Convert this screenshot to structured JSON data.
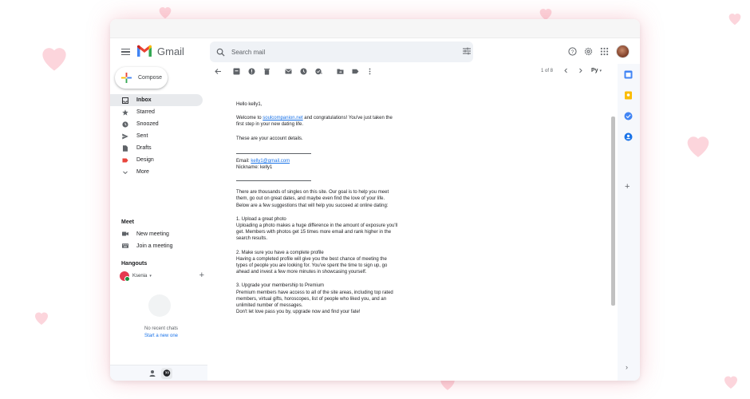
{
  "app": {
    "name": "Gmail"
  },
  "search": {
    "placeholder": "Search mail"
  },
  "compose": {
    "label": "Compose"
  },
  "nav": [
    {
      "label": "Inbox",
      "icon": "inbox-icon",
      "active": true
    },
    {
      "label": "Starred",
      "icon": "star-icon"
    },
    {
      "label": "Snoozed",
      "icon": "clock-icon"
    },
    {
      "label": "Sent",
      "icon": "send-icon"
    },
    {
      "label": "Drafts",
      "icon": "draft-icon"
    },
    {
      "label": "Design",
      "icon": "label-icon"
    },
    {
      "label": "More",
      "icon": "chevron-down-icon"
    }
  ],
  "meet": {
    "title": "Meet",
    "new_meeting": "New meeting",
    "join_meeting": "Join a meeting"
  },
  "hangouts": {
    "title": "Hangouts",
    "user": "Ksenia",
    "user_caret": "▾",
    "add": "+",
    "no_chats": "No recent chats",
    "start_chat": "Start a new one"
  },
  "pager": {
    "text": "1 of 8"
  },
  "lang": {
    "label": "Pу",
    "caret": "▾"
  },
  "email": {
    "greeting": "Hello kelly1,",
    "welcome_pre": "Welcome to ",
    "welcome_link": "soulcompanion.net",
    "welcome_post": " and congratulations! You've just taken the",
    "welcome_line2": "first step in your new dating life.",
    "account": "These are your account details.",
    "email_label": "Email: ",
    "email_value": "kelly1@gmail.com",
    "nickname": "Nickname: kelly1",
    "intro_l1": "There are thousands of singles on this site. Our goal is to help you meet",
    "intro_l2": "them, go out on great dates, and maybe even find the love of your life.",
    "intro_l3": "Below are a few suggestions that will help you succeed at online dating:",
    "s1_title": "1. Upload a great photo",
    "s1_l1": "Uploading a photo makes a huge difference in the amount of exposure you'll",
    "s1_l2": "get. Members with photos get 15 times more email and rank higher in the",
    "s1_l3": "search results.",
    "s2_title": "2. Make sure you have a complete profile",
    "s2_l1": "Having a completed profile will give you the best chance of meeting the",
    "s2_l2": "types of people you are looking for. You've spent the time to sign up, go",
    "s2_l3": "ahead and invest a few more minutes in showcasing yourself.",
    "s3_title": "3. Upgrade your membership to Premium",
    "s3_l1": "Premium members have access to all of the site areas, including top rated",
    "s3_l2": "members, virtual gifts, horoscopes, list of people who liked you, and an",
    "s3_l3": "unlimited number of messages.",
    "closing": "Don't let love pass you by, upgrade now and find your fate!"
  },
  "right_rail": {
    "add": "+",
    "chevron": "›"
  },
  "colors": {
    "accent": "#1a73e8",
    "heart": "#fcd3da",
    "gmail_red": "#ea4335",
    "design_label": "#e8453c"
  }
}
